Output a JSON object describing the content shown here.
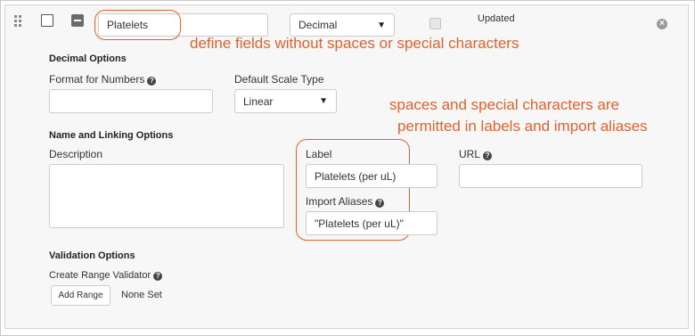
{
  "field": {
    "name": "Platelets",
    "data_type": "Decimal",
    "updated_label": "Updated"
  },
  "annotations": {
    "name_note": "define fields without spaces or special characters",
    "label_note_line1": "spaces and special characters are",
    "label_note_line2": "permitted in labels and import aliases",
    "color": "#e0622e"
  },
  "decimal_options": {
    "heading": "Decimal Options",
    "format_label": "Format for Numbers",
    "format_value": "",
    "scale_label": "Default Scale Type",
    "scale_value": "Linear"
  },
  "name_linking": {
    "heading": "Name and Linking Options",
    "description_label": "Description",
    "description_value": "",
    "label_label": "Label",
    "label_value": "Platelets (per uL)",
    "aliases_label": "Import Aliases",
    "aliases_value": "\"Platelets (per uL)\"",
    "url_label": "URL",
    "url_value": ""
  },
  "validation": {
    "heading": "Validation Options",
    "range_label": "Create Range Validator",
    "add_button": "Add Range",
    "status": "None Set"
  },
  "icons": {
    "help": "?",
    "close": "×",
    "caret": "▼"
  }
}
